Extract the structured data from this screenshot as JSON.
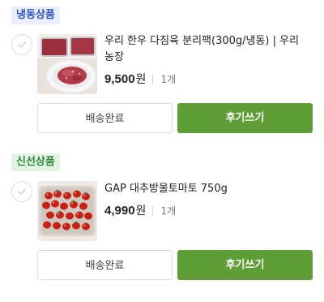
{
  "orders": [
    {
      "category": "냉동상품",
      "product_name": "우리 한우 다짐육 분리팩(300g/냉동) | 우리농장",
      "price": "9,500",
      "currency": "원",
      "quantity": "1개",
      "delivered_label": "배송완료",
      "review_label": "후기쓰기",
      "thumbnail_icon": "ground-beef-image"
    },
    {
      "category": "신선상품",
      "product_name": "GAP 대추방울토마토 750g",
      "price": "4,990",
      "currency": "원",
      "quantity": "1개",
      "delivered_label": "배송완료",
      "review_label": "후기쓰기",
      "thumbnail_icon": "cherry-tomato-image"
    }
  ],
  "colors": {
    "accent": "#5f9e37",
    "frozen_tag_bg": "#e8eefc",
    "frozen_tag_text": "#2f55c6",
    "fresh_tag_bg": "#e3f4e4",
    "fresh_tag_text": "#2e8b3d"
  }
}
